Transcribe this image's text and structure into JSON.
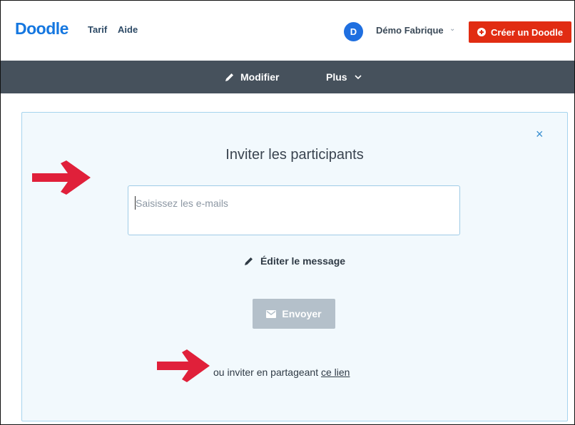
{
  "header": {
    "logo": "Doodle",
    "nav": [
      "Tarif",
      "Aide"
    ],
    "avatar_initial": "D",
    "user_name": "Démo Fabrique",
    "create_button": "Créer un Doodle"
  },
  "toolbar": {
    "modifier_label": "Modifier",
    "plus_label": "Plus"
  },
  "invite": {
    "title": "Inviter les participants",
    "email_placeholder": "Saisissez les e-mails",
    "edit_message": "Éditer le message",
    "send_button": "Envoyer",
    "share_prefix": "ou inviter en partageant ",
    "share_link": "ce lien",
    "close_symbol": "×"
  },
  "colors": {
    "brand_blue": "#1577e0",
    "create_red": "#e12c12",
    "toolbar_dark": "#46515c",
    "panel_bg": "#f2f9fd",
    "send_disabled": "#b4c0ca",
    "annotation_arrow": "#e0203a"
  },
  "icons": {
    "modifier": "pencil-icon",
    "edit_message": "pencil-icon",
    "send": "envelope-icon",
    "create": "plus-circle-icon",
    "dropdown": "chevron-down-icon",
    "close": "close-icon"
  }
}
